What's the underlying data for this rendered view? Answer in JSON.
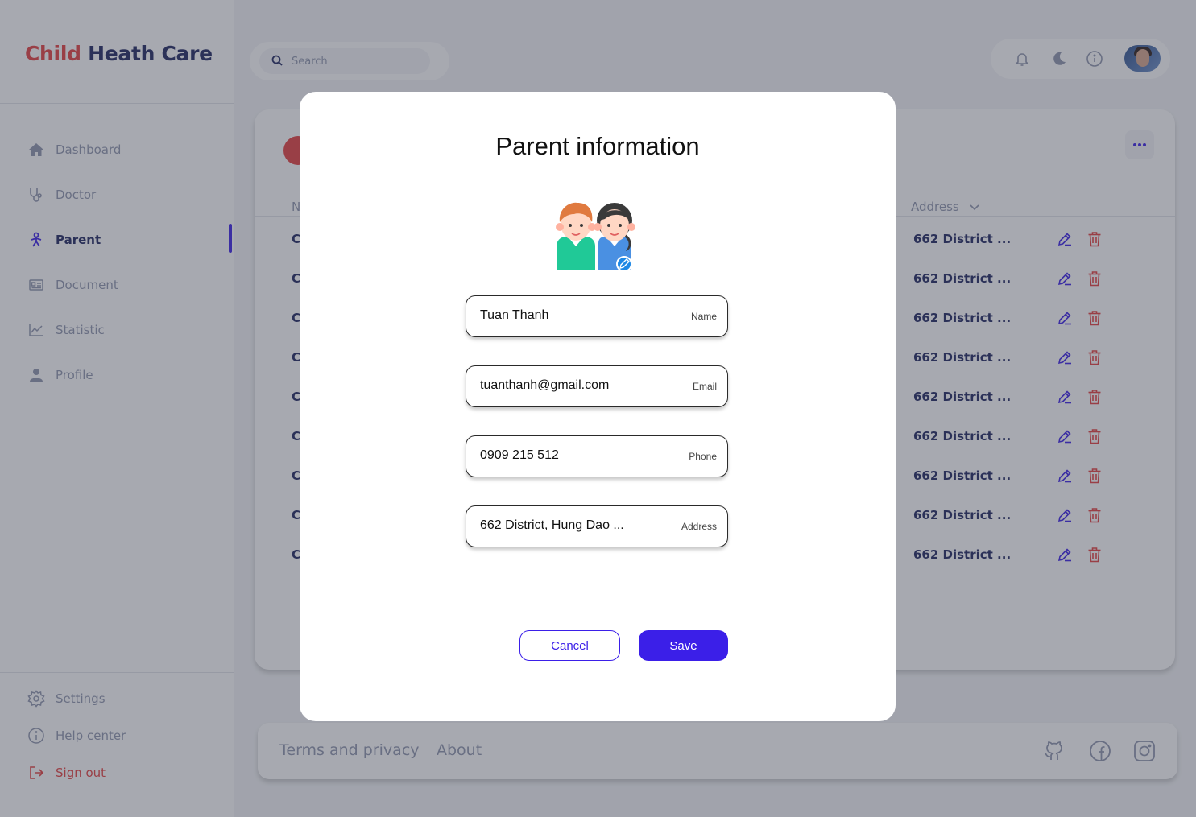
{
  "brand": {
    "part1": "Child",
    "part2": "Heath Care"
  },
  "search": {
    "placeholder": "Search"
  },
  "sidebar": {
    "items": [
      {
        "label": "Dashboard",
        "icon": "home-icon"
      },
      {
        "label": "Doctor",
        "icon": "stethoscope-icon"
      },
      {
        "label": "Parent",
        "icon": "parent-icon",
        "active": true
      },
      {
        "label": "Document",
        "icon": "document-icon"
      },
      {
        "label": "Statistic",
        "icon": "chart-icon"
      },
      {
        "label": "Profile",
        "icon": "profile-icon"
      }
    ],
    "bottom": [
      {
        "label": "Settings",
        "icon": "gear-icon"
      },
      {
        "label": "Help center",
        "icon": "info-icon"
      },
      {
        "label": "Sign out",
        "icon": "sign-out-icon"
      }
    ]
  },
  "topbar": {
    "icons": [
      "bell-icon",
      "moon-icon",
      "info-icon",
      "avatar"
    ]
  },
  "table": {
    "first_header": "N",
    "address_header": "Address",
    "rows": [
      {
        "first": "C",
        "address": "662 District ..."
      },
      {
        "first": "C",
        "address": "662 District ..."
      },
      {
        "first": "C",
        "address": "662 District ..."
      },
      {
        "first": "C",
        "address": "662 District ..."
      },
      {
        "first": "C",
        "address": "662 District ..."
      },
      {
        "first": "C",
        "address": "662 District ..."
      },
      {
        "first": "C",
        "address": "662 District ..."
      },
      {
        "first": "C",
        "address": "662 District ..."
      },
      {
        "first": "C",
        "address": "662 District ..."
      }
    ]
  },
  "footer": {
    "terms": "Terms and privacy",
    "about": "About",
    "icons": [
      "github-icon",
      "facebook-icon",
      "instagram-icon"
    ]
  },
  "modal": {
    "title": "Parent information",
    "fields": [
      {
        "value": "Tuan Thanh",
        "label": "Name"
      },
      {
        "value": "tuanthanh@gmail.com",
        "label": "Email"
      },
      {
        "value": "0909 215 512",
        "label": "Phone"
      },
      {
        "value": "662 District, Hung Dao ...",
        "label": "Address"
      }
    ],
    "cancel": "Cancel",
    "save": "Save"
  },
  "colors": {
    "accent": "#3b1fe8",
    "brand_red": "#e63e3e",
    "brand_navy": "#1e2560",
    "muted": "#8f95ad"
  }
}
